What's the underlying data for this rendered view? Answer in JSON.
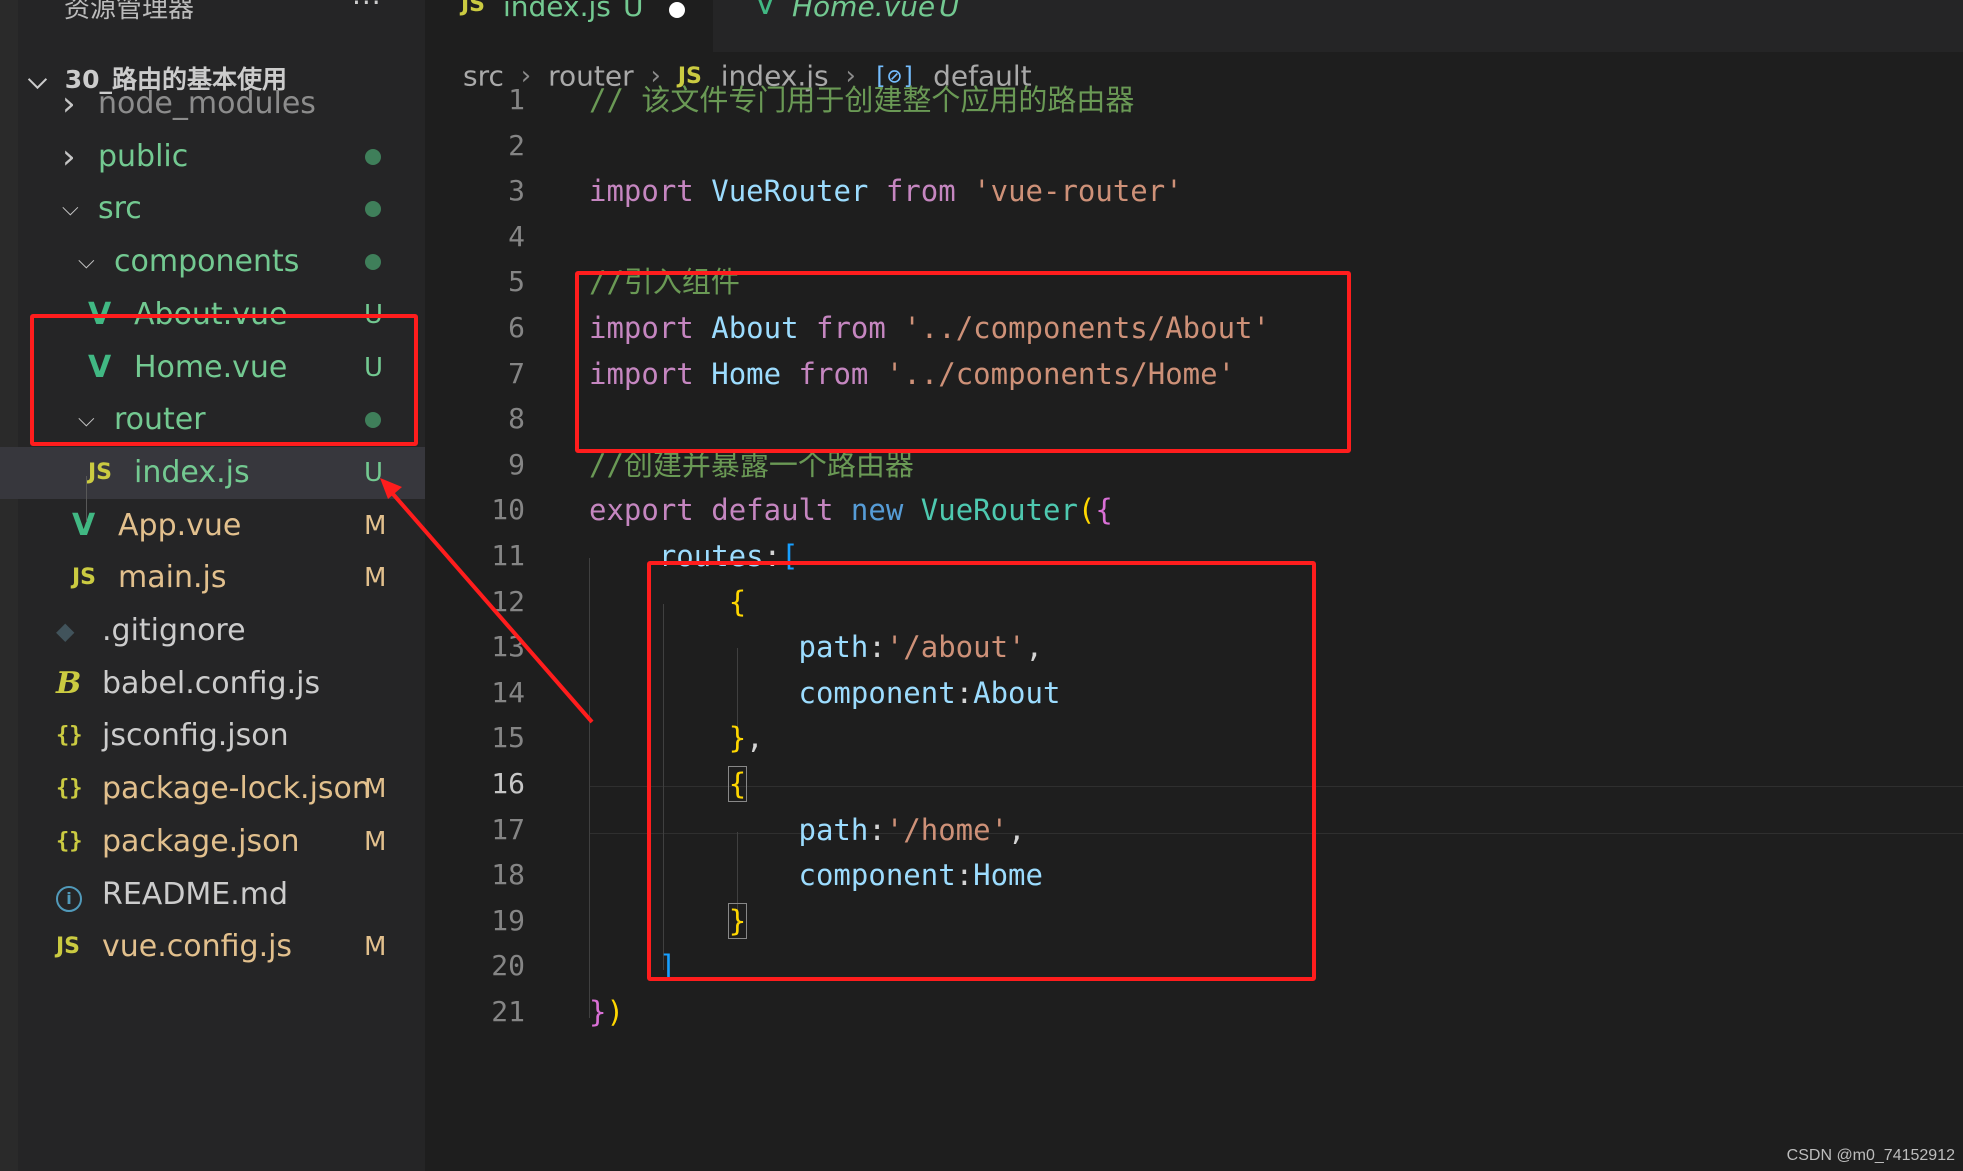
{
  "explorer": {
    "title": "资源管理器",
    "more_icon": "ellipsis-icon",
    "project": "30_路由的基本使用",
    "items": [
      {
        "name": "node_modules",
        "type": "folder",
        "expanded": false,
        "status": "",
        "color": "#8c8c8c"
      },
      {
        "name": "public",
        "type": "folder",
        "expanded": false,
        "status": "dot",
        "color": "#73c991"
      },
      {
        "name": "src",
        "type": "folder",
        "expanded": true,
        "status": "dot",
        "color": "#73c991"
      },
      {
        "name": "components",
        "type": "folder",
        "expanded": true,
        "status": "dot",
        "color": "#73c991"
      },
      {
        "name": "About.vue",
        "type": "vue",
        "status": "U",
        "color": "#73c991"
      },
      {
        "name": "Home.vue",
        "type": "vue",
        "status": "U",
        "color": "#73c991"
      },
      {
        "name": "router",
        "type": "folder",
        "expanded": true,
        "status": "dot",
        "color": "#73c991"
      },
      {
        "name": "index.js",
        "type": "js",
        "status": "U",
        "color": "#73c991"
      },
      {
        "name": "App.vue",
        "type": "vue",
        "status": "M",
        "color": "#e2c08d"
      },
      {
        "name": "main.js",
        "type": "js",
        "status": "M",
        "color": "#e2c08d"
      },
      {
        "name": ".gitignore",
        "type": "git",
        "status": "",
        "color": "#cccccc"
      },
      {
        "name": "babel.config.js",
        "type": "babel",
        "status": "",
        "color": "#cccccc"
      },
      {
        "name": "jsconfig.json",
        "type": "json",
        "status": "",
        "color": "#cccccc"
      },
      {
        "name": "package-lock.json",
        "type": "json",
        "status": "M",
        "color": "#e2c08d"
      },
      {
        "name": "package.json",
        "type": "json",
        "status": "M",
        "color": "#e2c08d"
      },
      {
        "name": "README.md",
        "type": "info",
        "status": "",
        "color": "#cccccc"
      },
      {
        "name": "vue.config.js",
        "type": "js",
        "status": "M",
        "color": "#e2c08d"
      }
    ]
  },
  "tabs": [
    {
      "icon": "JS",
      "name": "index.js",
      "status": "U",
      "dirty": true,
      "active": true
    },
    {
      "icon": "V",
      "name": "Home.vue",
      "status": "U",
      "dirty": false,
      "active": false
    }
  ],
  "breadcrumb": {
    "parts": [
      "src",
      "router"
    ],
    "file_icon": "JS",
    "file": "index.js",
    "symbol_icon": "[⊘]",
    "symbol": "default"
  },
  "editor": {
    "current_line": 16,
    "lines": [
      {
        "n": "1",
        "tokens": [
          [
            "cmt",
            "// 该文件专门用于创建整个应用的路由器"
          ]
        ]
      },
      {
        "n": "2",
        "tokens": []
      },
      {
        "n": "3",
        "tokens": [
          [
            "kw",
            "import"
          ],
          [
            "plain",
            " "
          ],
          [
            "var",
            "VueRouter"
          ],
          [
            "plain",
            " "
          ],
          [
            "kw",
            "from"
          ],
          [
            "plain",
            " "
          ],
          [
            "str",
            "'vue-router'"
          ]
        ]
      },
      {
        "n": "4",
        "tokens": []
      },
      {
        "n": "5",
        "tokens": [
          [
            "cmt",
            "//引入组件"
          ]
        ]
      },
      {
        "n": "6",
        "tokens": [
          [
            "kw",
            "import"
          ],
          [
            "plain",
            " "
          ],
          [
            "var",
            "About"
          ],
          [
            "plain",
            " "
          ],
          [
            "kw",
            "from"
          ],
          [
            "plain",
            " "
          ],
          [
            "str",
            "'../components/About'"
          ]
        ]
      },
      {
        "n": "7",
        "tokens": [
          [
            "kw",
            "import"
          ],
          [
            "plain",
            " "
          ],
          [
            "var",
            "Home"
          ],
          [
            "plain",
            " "
          ],
          [
            "kw",
            "from"
          ],
          [
            "plain",
            " "
          ],
          [
            "str",
            "'../components/Home'"
          ]
        ]
      },
      {
        "n": "8",
        "tokens": []
      },
      {
        "n": "9",
        "tokens": [
          [
            "cmt",
            "//创建并暴露一个路由器"
          ]
        ]
      },
      {
        "n": "10",
        "tokens": [
          [
            "kw",
            "export"
          ],
          [
            "plain",
            " "
          ],
          [
            "kw",
            "default"
          ],
          [
            "plain",
            " "
          ],
          [
            "kw2",
            "new"
          ],
          [
            "plain",
            " "
          ],
          [
            "cls",
            "VueRouter"
          ],
          [
            "b1",
            "("
          ],
          [
            "b2",
            "{"
          ]
        ]
      },
      {
        "n": "11",
        "tokens": [
          [
            "plain",
            "    "
          ],
          [
            "var",
            "routes"
          ],
          [
            "plain",
            ":"
          ],
          [
            "b3",
            "["
          ]
        ]
      },
      {
        "n": "12",
        "tokens": [
          [
            "plain",
            "        "
          ],
          [
            "b1",
            "{"
          ]
        ]
      },
      {
        "n": "13",
        "tokens": [
          [
            "plain",
            "            "
          ],
          [
            "var",
            "path"
          ],
          [
            "plain",
            ":"
          ],
          [
            "str",
            "'/about'"
          ],
          [
            "plain",
            ","
          ]
        ]
      },
      {
        "n": "14",
        "tokens": [
          [
            "plain",
            "            "
          ],
          [
            "var",
            "component"
          ],
          [
            "plain",
            ":"
          ],
          [
            "var",
            "About"
          ]
        ]
      },
      {
        "n": "15",
        "tokens": [
          [
            "plain",
            "        "
          ],
          [
            "b1",
            "}"
          ],
          [
            "plain",
            ","
          ]
        ]
      },
      {
        "n": "16",
        "tokens": [
          [
            "plain",
            "        "
          ],
          [
            "b1m",
            "{"
          ]
        ]
      },
      {
        "n": "17",
        "tokens": [
          [
            "plain",
            "            "
          ],
          [
            "var",
            "path"
          ],
          [
            "plain",
            ":"
          ],
          [
            "str",
            "'/home'"
          ],
          [
            "plain",
            ","
          ]
        ]
      },
      {
        "n": "18",
        "tokens": [
          [
            "plain",
            "            "
          ],
          [
            "var",
            "component"
          ],
          [
            "plain",
            ":"
          ],
          [
            "var",
            "Home"
          ]
        ]
      },
      {
        "n": "19",
        "tokens": [
          [
            "plain",
            "        "
          ],
          [
            "b1m",
            "}"
          ]
        ]
      },
      {
        "n": "20",
        "tokens": [
          [
            "plain",
            "    "
          ],
          [
            "b3",
            "]"
          ]
        ]
      },
      {
        "n": "21",
        "tokens": [
          [
            "b2",
            "}"
          ],
          [
            "b1",
            ")"
          ]
        ]
      }
    ]
  },
  "watermark": "CSDN @m0_74152912",
  "annotation_color": "#ff1d1d"
}
